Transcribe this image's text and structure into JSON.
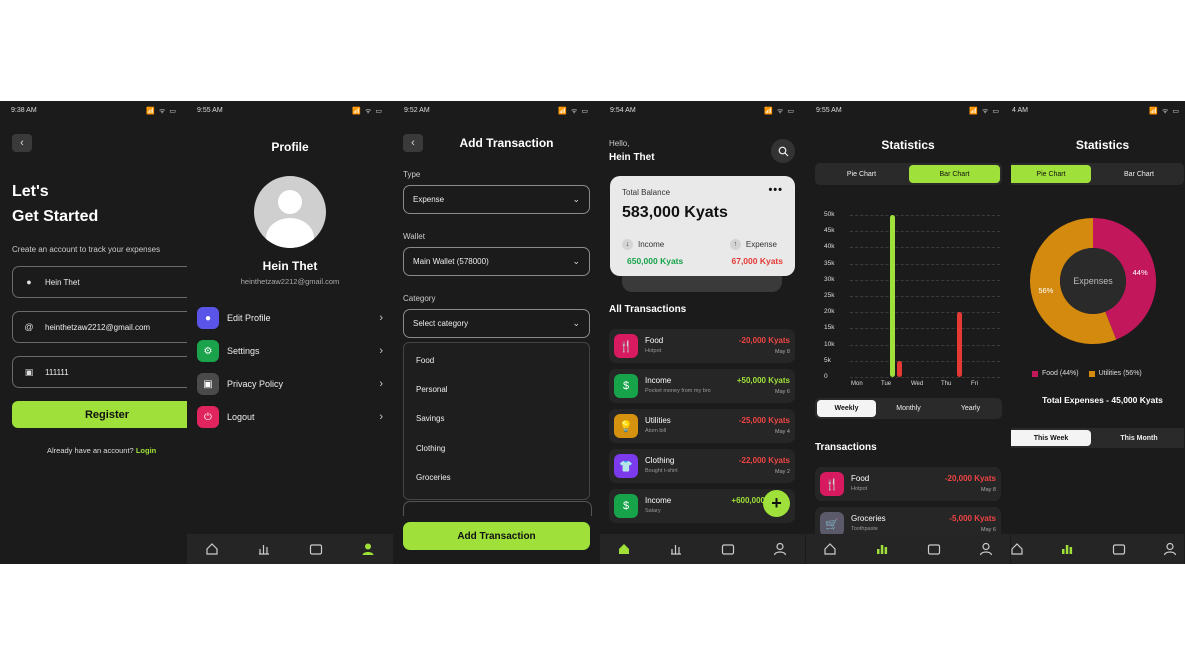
{
  "screens": {
    "register": {
      "time": "9:38 AM",
      "heading_line1": "Let's",
      "heading_line2": "Get Started",
      "subtitle": "Create an account to track your expenses",
      "name_value": "Hein Thet",
      "email_value": "heinthetzaw2212@gmail.com",
      "password_value": "111111",
      "register_label": "Register",
      "have_account_text": "Already have an account?",
      "login_link": "Login"
    },
    "profile": {
      "time": "9:55 AM",
      "title": "Profile",
      "name": "Hein Thet",
      "email": "heinthetzaw2212@gmail.com",
      "menu": [
        {
          "label": "Edit Profile",
          "color": "#5a55e8"
        },
        {
          "label": "Settings",
          "color": "#1aa34a"
        },
        {
          "label": "Privacy Policy",
          "color": "#4a4a4a"
        },
        {
          "label": "Logout",
          "color": "#e0245e"
        }
      ]
    },
    "add_transaction": {
      "time": "9:52 AM",
      "title": "Add Transaction",
      "type_label": "Type",
      "type_value": "Expense",
      "wallet_label": "Wallet",
      "wallet_value": "Main Wallet (578000)",
      "category_label": "Category",
      "category_placeholder": "Select category",
      "category_options": [
        "Food",
        "Personal",
        "Savings",
        "Clothing",
        "Groceries"
      ],
      "submit_label": "Add Transaction"
    },
    "home": {
      "time": "9:54 AM",
      "greeting": "Hello,",
      "user": "Hein Thet",
      "balance_label": "Total Balance",
      "balance_value": "583,000 Kyats",
      "income_label": "Income",
      "income_value": "650,000 Kyats",
      "expense_label": "Expense",
      "expense_value": "67,000 Kyats",
      "all_transactions": "All Transactions",
      "transactions": [
        {
          "name": "Food",
          "note": "Hotpot",
          "amount": "-20,000 Kyats",
          "date": "May 8",
          "color": "#d81b60",
          "icon": "🍴"
        },
        {
          "name": "Income",
          "note": "Pocket money from my bro",
          "amount": "+50,000 Kyats",
          "date": "May 6",
          "color": "#16a34a",
          "icon": "$"
        },
        {
          "name": "Utilities",
          "note": "Atom bill",
          "amount": "-25,000 Kyats",
          "date": "May 4",
          "color": "#d4920f",
          "icon": "💡"
        },
        {
          "name": "Clothing",
          "note": "Bought t-shirt",
          "amount": "-22,000 Kyats",
          "date": "May 2",
          "color": "#7c3aed",
          "icon": "👕"
        },
        {
          "name": "Income",
          "note": "Salary",
          "amount": "+600,000",
          "date": "",
          "color": "#16a34a",
          "icon": "$"
        }
      ]
    },
    "stats_bar": {
      "time": "9:55 AM",
      "title": "Statistics",
      "tab_pie": "Pie Chart",
      "tab_bar": "Bar Chart",
      "period_weekly": "Weekly",
      "period_monthly": "Monthly",
      "period_yearly": "Yearly",
      "transactions_title": "Transactions",
      "transactions": [
        {
          "name": "Food",
          "note": "Hotpot",
          "amount": "-20,000 Kyats",
          "date": "May 8",
          "color": "#d81b60",
          "icon": "🍴"
        },
        {
          "name": "Groceries",
          "note": "Toothpaste",
          "amount": "-5,000 Kyats",
          "date": "May 6",
          "color": "#5a5a6a",
          "icon": "🛒"
        }
      ]
    },
    "stats_pie": {
      "time": "4 AM",
      "title": "Statistics",
      "tab_pie": "Pie Chart",
      "tab_bar": "Bar Chart",
      "center_label": "Expenses",
      "legend_food": "Food (44%)",
      "legend_utilities": "Utilities (56%)",
      "total_text": "Total Expenses - 45,000 Kyats",
      "this_week": "This Week",
      "this_month": "This Month"
    }
  },
  "chart_data": [
    {
      "type": "bar",
      "categories": [
        "Mon",
        "Tue",
        "Wed",
        "Thu",
        "Fri"
      ],
      "series": [
        {
          "values": [
            0,
            50000,
            0,
            0,
            0
          ],
          "color": "#9fe13a"
        },
        {
          "values": [
            0,
            5000,
            0,
            20000,
            0
          ],
          "color": "#e53935"
        }
      ],
      "yticks": [
        "50k",
        "45k",
        "40k",
        "35k",
        "30k",
        "25k",
        "20k",
        "15k",
        "10k",
        "5k",
        "0"
      ],
      "ylim": [
        0,
        50000
      ]
    },
    {
      "type": "pie",
      "labels": [
        "Food",
        "Utilities"
      ],
      "values": [
        44,
        56
      ],
      "value_labels": [
        "44%",
        "56%"
      ],
      "colors": [
        "#c2185b",
        "#d4890f"
      ]
    }
  ],
  "status_icons": "📶 ᯤ ▭"
}
